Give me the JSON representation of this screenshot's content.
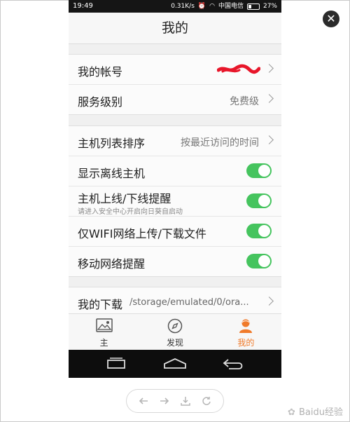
{
  "status_bar": {
    "time": "19:49",
    "speed": "0.31K/s",
    "carrier": "中国电信",
    "battery": "27%"
  },
  "header": {
    "title": "我的"
  },
  "account_group": {
    "account_label": "我的帐号",
    "service_label": "服务级别",
    "service_value": "免费级"
  },
  "settings_group": {
    "sort_label": "主机列表排序",
    "sort_value": "按最近访问的时间",
    "offline_label": "显示离线主机",
    "online_alert_label": "主机上线/下线提醒",
    "online_alert_hint": "请进入安全中心开启向日葵自启动",
    "wifi_only_label": "仅WIFI网络上传/下载文件",
    "mobile_alert_label": "移动网络提醒",
    "toggles": {
      "offline": true,
      "online_alert": true,
      "wifi_only": true,
      "mobile_alert": true
    },
    "accent_color": "#45c45e"
  },
  "download_group": {
    "label": "我的下载",
    "path": "/storage/emulated/0/ora..."
  },
  "tabs": [
    {
      "label": "主",
      "icon": "image-icon",
      "active": false
    },
    {
      "label": "发现",
      "icon": "compass-icon",
      "active": false
    },
    {
      "label": "我的",
      "icon": "person-icon",
      "active": true
    }
  ],
  "active_tab_color": "#f07a2a",
  "watermark": {
    "text": "Baidu经验"
  }
}
